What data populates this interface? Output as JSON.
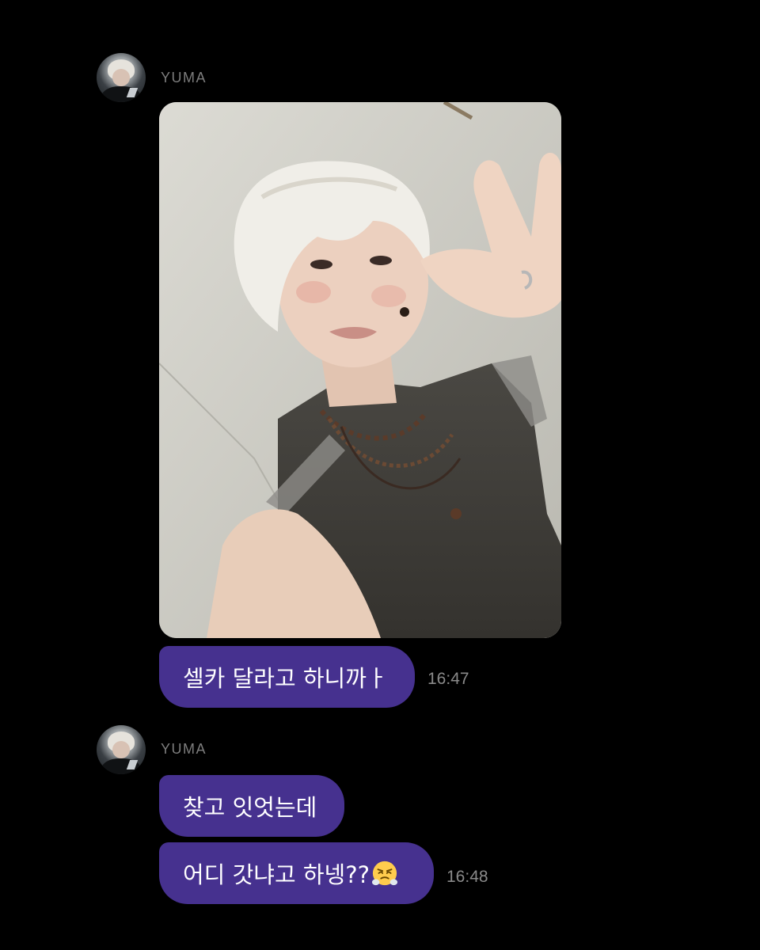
{
  "messages": [
    {
      "sender": "YUMA",
      "photo_alt": "selfie",
      "bubbles": [
        {
          "text": "셀카 달라고 하니까ㅏ",
          "time": "16:47"
        }
      ]
    },
    {
      "sender": "YUMA",
      "bubbles": [
        {
          "text": "찾고 잇엇는데"
        },
        {
          "text": "어디 갓냐고 하넹??",
          "emoji": "face-with-steam-from-nose-emoji",
          "time": "16:48"
        }
      ]
    }
  ],
  "colors": {
    "background": "#000000",
    "bubble": "#46318f",
    "sender_name": "#7d7d7d",
    "timestamp": "#8a8a8a"
  }
}
